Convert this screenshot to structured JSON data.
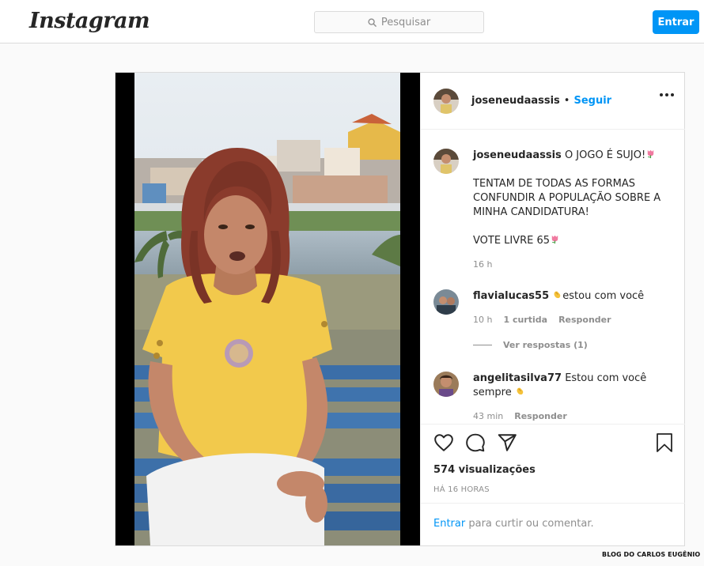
{
  "topbar": {
    "logo": "Instagram",
    "search_placeholder": "Pesquisar",
    "login_label": "Entrar"
  },
  "post": {
    "author": "joseneudaassis",
    "dot": "•",
    "follow_label": "Seguir",
    "caption": {
      "username": "joseneudaassis",
      "line1": "O JOGO É SUJO!",
      "line2": "TENTAM DE TODAS AS FORMAS",
      "line3": "CONFUNDIR A POPULAÇÃO SOBRE A",
      "line4": "MINHA CANDIDATURA!",
      "line5": "VOTE LIVRE 65",
      "time": "16 h"
    },
    "comments": [
      {
        "username": "flavialucas55",
        "text": "estou com você",
        "time": "10 h",
        "likes": "1 curtida",
        "reply": "Responder",
        "view_replies": "Ver respostas (1)"
      },
      {
        "username": "angelitasilva77",
        "text_line1": "Estou com você",
        "text_line2": "sempre",
        "time": "43 min",
        "reply": "Responder"
      }
    ],
    "views": "574 visualizações",
    "posted": "HÁ 16 HORAS",
    "footer": {
      "login_link": "Entrar",
      "rest": " para curtir ou comentar."
    }
  },
  "watermark": "BLOG DO CARLOS EUGÊNIO",
  "icons": {
    "like": "heart-icon",
    "comment": "comment-bubble-icon",
    "share": "paper-plane-icon",
    "save": "bookmark-icon",
    "more": "ellipsis-icon",
    "search": "search-icon",
    "tulip": "tulip-emoji",
    "clap": "clapping-hands-emoji"
  },
  "colors": {
    "accent": "#0095f6",
    "border": "#dbdbdb",
    "muted": "#8e8e8e",
    "text": "#262626",
    "shirt": "#f2c94c"
  }
}
